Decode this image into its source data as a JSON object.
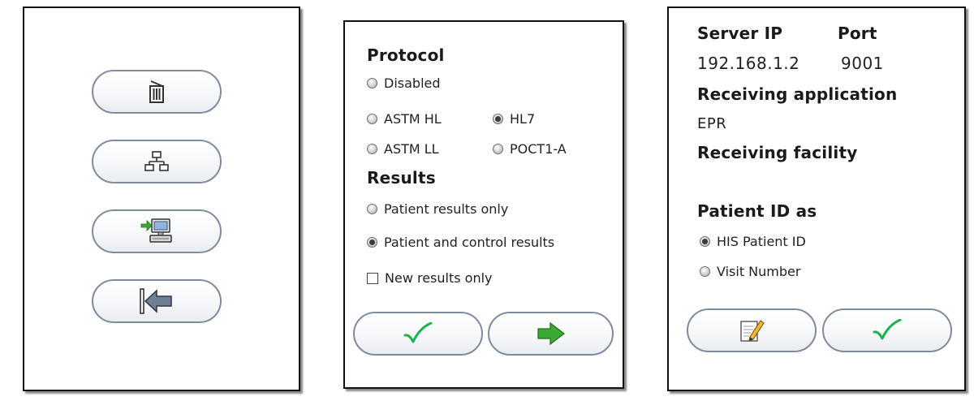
{
  "left_panel": {
    "buttons": [
      {
        "icon": "trash-icon"
      },
      {
        "icon": "network-icon"
      },
      {
        "icon": "computer-transfer-icon"
      },
      {
        "icon": "back-arrow-icon"
      }
    ]
  },
  "protocol_panel": {
    "protocol_title": "Protocol",
    "protocol_options": [
      "Disabled",
      "ASTM HL",
      "HL7",
      "ASTM LL",
      "POCT1-A"
    ],
    "protocol_selected": "HL7",
    "results_title": "Results",
    "results_options": [
      "Patient results only",
      "Patient and control results"
    ],
    "results_selected": "Patient and control results",
    "new_results_label": "New results only",
    "new_results_checked": false,
    "buttons": {
      "confirm_icon": "checkmark-icon",
      "next_icon": "arrow-right-icon"
    }
  },
  "server_panel": {
    "server_ip_label": "Server IP",
    "port_label": "Port",
    "server_ip": "192.168.1.2",
    "port": "9001",
    "receiving_application_label": "Receiving application",
    "receiving_application": "EPR",
    "receiving_facility_label": "Receiving facility",
    "receiving_facility": "",
    "patient_id_title": "Patient ID as",
    "patient_id_options": [
      "HIS Patient ID",
      "Visit Number"
    ],
    "patient_id_selected": "HIS Patient ID",
    "buttons": {
      "edit_icon": "edit-note-icon",
      "confirm_icon": "checkmark-icon"
    }
  },
  "colors": {
    "check_green": "#1db34a",
    "arrow_green": "#3aaa35",
    "pill_border": "#7f8c9e"
  }
}
